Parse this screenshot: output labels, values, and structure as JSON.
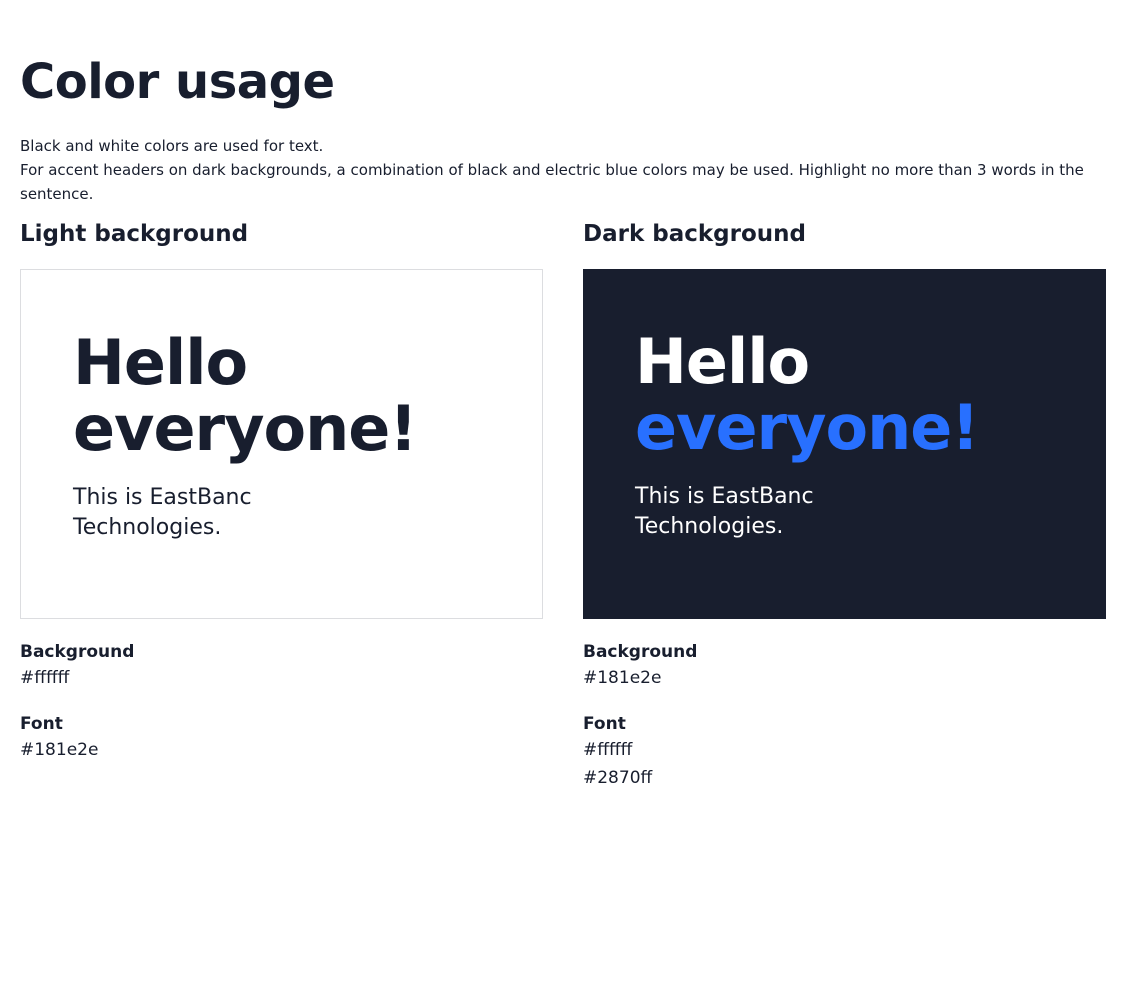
{
  "page": {
    "title": "Color usage",
    "intro": [
      "Black and white colors are used for text.",
      "For accent headers on dark backgrounds, a combination of black and electric blue colors may be used. Highlight no more than 3 words in the sentence."
    ]
  },
  "light": {
    "heading": "Light background",
    "sample": {
      "headline_line_1": "Hello",
      "headline_line_2": "everyone!",
      "body": "This is EastBanc Technologies."
    },
    "background_label": "Background",
    "background_value": "#ffffff",
    "font_label": "Font",
    "font_values": [
      "#181e2e"
    ]
  },
  "dark": {
    "heading": "Dark background",
    "sample": {
      "headline_line_1": "Hello",
      "headline_line_2": "everyone!",
      "body": "This is EastBanc Technologies."
    },
    "background_label": "Background",
    "background_value": "#181e2e",
    "font_label": "Font",
    "font_values": [
      "#ffffff",
      "#2870ff"
    ]
  },
  "colors": {
    "dark": "#181e2e",
    "white": "#ffffff",
    "electric_blue": "#2870ff"
  }
}
